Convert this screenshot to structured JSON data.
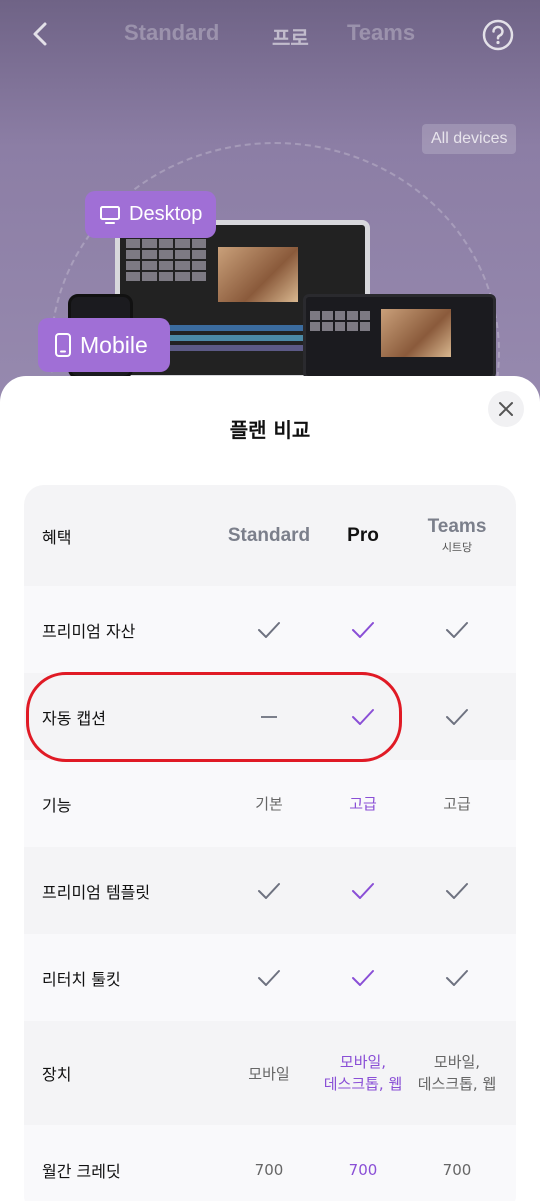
{
  "topbar": {
    "tabs": [
      {
        "label": "Standard"
      },
      {
        "label": "프로"
      },
      {
        "label": "Teams"
      }
    ]
  },
  "hero": {
    "badge": "All devices",
    "desktop_label": "Desktop",
    "mobile_label": "Mobile"
  },
  "sheet": {
    "title": "플랜 비교",
    "header": {
      "label": "혜택",
      "standard": "Standard",
      "pro": "Pro",
      "teams": "Teams",
      "teams_sub": "시트당"
    },
    "rows": [
      {
        "label": "프리미엄 자산",
        "standard": "check",
        "pro": "check",
        "teams": "check"
      },
      {
        "label": "자동 캡션",
        "standard": "dash",
        "pro": "check",
        "teams": "check"
      },
      {
        "label": "기능",
        "standard": "기본",
        "pro": "고급",
        "teams": "고급"
      },
      {
        "label": "프리미엄 템플릿",
        "standard": "check",
        "pro": "check",
        "teams": "check"
      },
      {
        "label": "리터치 툴킷",
        "standard": "check",
        "pro": "check",
        "teams": "check"
      },
      {
        "label": "장치",
        "standard": "모바일",
        "pro_line1": "모바일,",
        "pro_line2": "데스크톱, 웹",
        "teams_line1": "모바일,",
        "teams_line2": "데스크톱, 웹"
      },
      {
        "label": "월간 크레딧",
        "standard": "700",
        "pro": "700",
        "teams": "700"
      }
    ]
  },
  "colors": {
    "accent": "#8a4fd6",
    "pill": "#a06fd6",
    "highlight": "#e01a25"
  }
}
